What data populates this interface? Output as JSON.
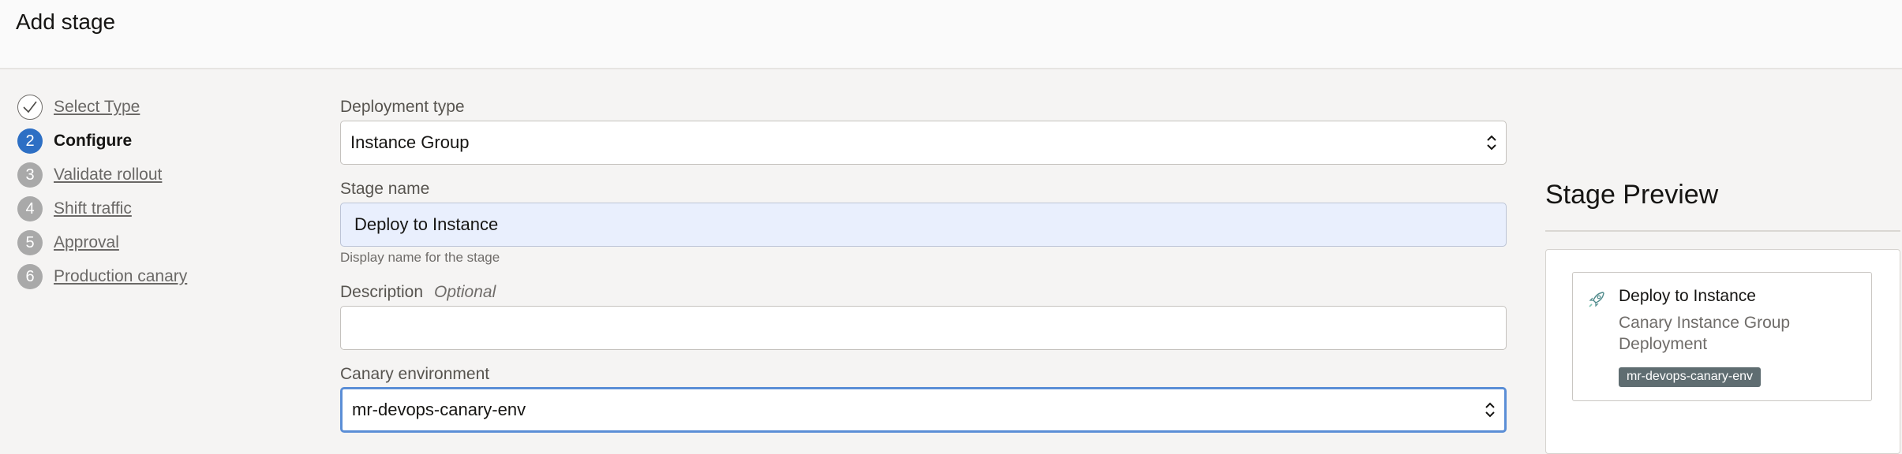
{
  "header": {
    "title": "Add stage"
  },
  "steps": [
    {
      "number": "",
      "label": "Select Type",
      "state": "done"
    },
    {
      "number": "2",
      "label": "Configure",
      "state": "current"
    },
    {
      "number": "3",
      "label": "Validate rollout",
      "state": "pending"
    },
    {
      "number": "4",
      "label": "Shift traffic",
      "state": "pending"
    },
    {
      "number": "5",
      "label": "Approval",
      "state": "pending"
    },
    {
      "number": "6",
      "label": "Production canary",
      "state": "pending"
    }
  ],
  "form": {
    "deployment_type": {
      "label": "Deployment type",
      "value": "Instance Group"
    },
    "stage_name": {
      "label": "Stage name",
      "value": "Deploy to Instance",
      "hint": "Display name for the stage"
    },
    "description": {
      "label": "Description",
      "optional": "Optional",
      "value": ""
    },
    "canary_environment": {
      "label": "Canary environment",
      "value": "mr-devops-canary-env"
    }
  },
  "preview": {
    "title": "Stage Preview",
    "card": {
      "icon": "rocket-icon",
      "name": "Deploy to Instance",
      "subtitle": "Canary Instance Group Deployment",
      "environment": "mr-devops-canary-env"
    }
  },
  "colors": {
    "accent": "#2d6fc4",
    "focus_border": "#5b8ed6",
    "badge_bg": "#5f6d71",
    "filled_input_bg": "#e9effd"
  }
}
